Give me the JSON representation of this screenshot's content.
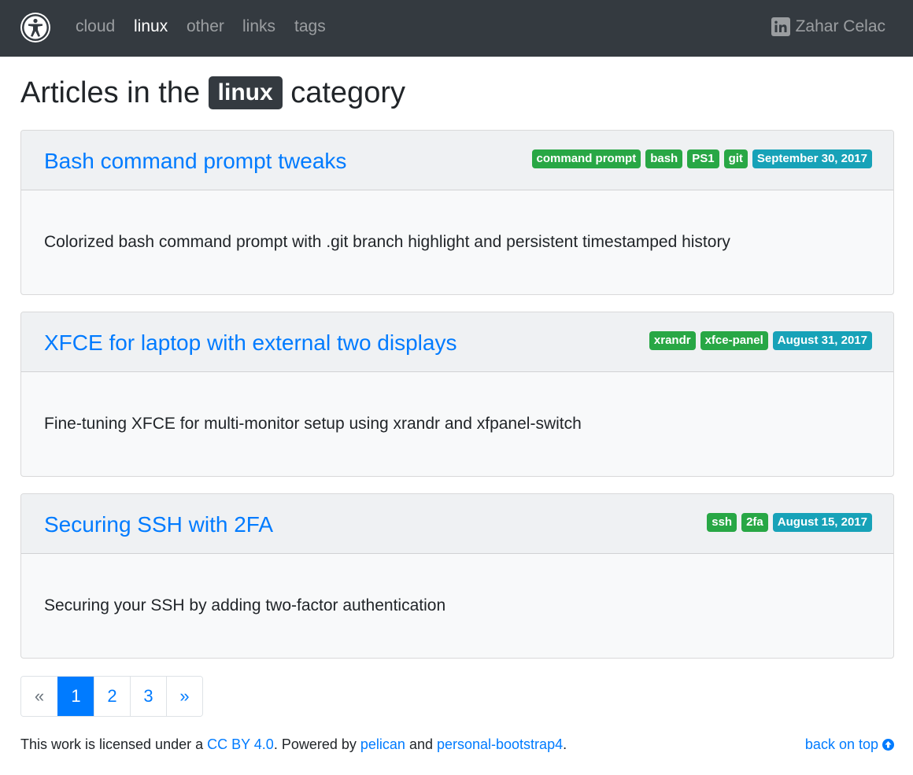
{
  "nav": {
    "brand_icon": "accessibility-icon",
    "items": [
      {
        "label": "cloud",
        "active": false
      },
      {
        "label": "linux",
        "active": true
      },
      {
        "label": "other",
        "active": false
      },
      {
        "label": "links",
        "active": false
      },
      {
        "label": "tags",
        "active": false
      }
    ],
    "author": {
      "icon": "linkedin-icon",
      "name": "Zahar Celac"
    }
  },
  "heading": {
    "prefix": "Articles in the",
    "badge": "linux",
    "suffix": "category"
  },
  "articles": [
    {
      "title": "Bash command prompt tweaks",
      "tags": [
        "command prompt",
        "bash",
        "PS1",
        "git"
      ],
      "date": "September 30, 2017",
      "summary": "Colorized bash command prompt with .git branch highlight and persistent timestamped history"
    },
    {
      "title": "XFCE for laptop with external two displays",
      "tags": [
        "xrandr",
        "xfce-panel"
      ],
      "date": "August 31, 2017",
      "summary": "Fine-tuning XFCE for multi-monitor setup using xrandr and xfpanel-switch"
    },
    {
      "title": "Securing SSH with 2FA",
      "tags": [
        "ssh",
        "2fa"
      ],
      "date": "August 15, 2017",
      "summary": "Securing your SSH by adding two-factor authentication"
    }
  ],
  "pagination": {
    "prev": "«",
    "pages": [
      "1",
      "2",
      "3"
    ],
    "current": "1",
    "next": "»"
  },
  "footer": {
    "text1": "This work is licensed under a ",
    "license_link": "CC BY 4.0",
    "text2": ". Powered by ",
    "pelican_link": "pelican",
    "text3": " and ",
    "theme_link": "personal-bootstrap4",
    "text4": ".",
    "back_on_top": "back on top",
    "back_icon": "arrow-up-circle-icon"
  },
  "colors": {
    "navbar": "#343a40",
    "link": "#007bff",
    "tag_badge": "#28a745",
    "date_badge": "#17a2b8"
  }
}
